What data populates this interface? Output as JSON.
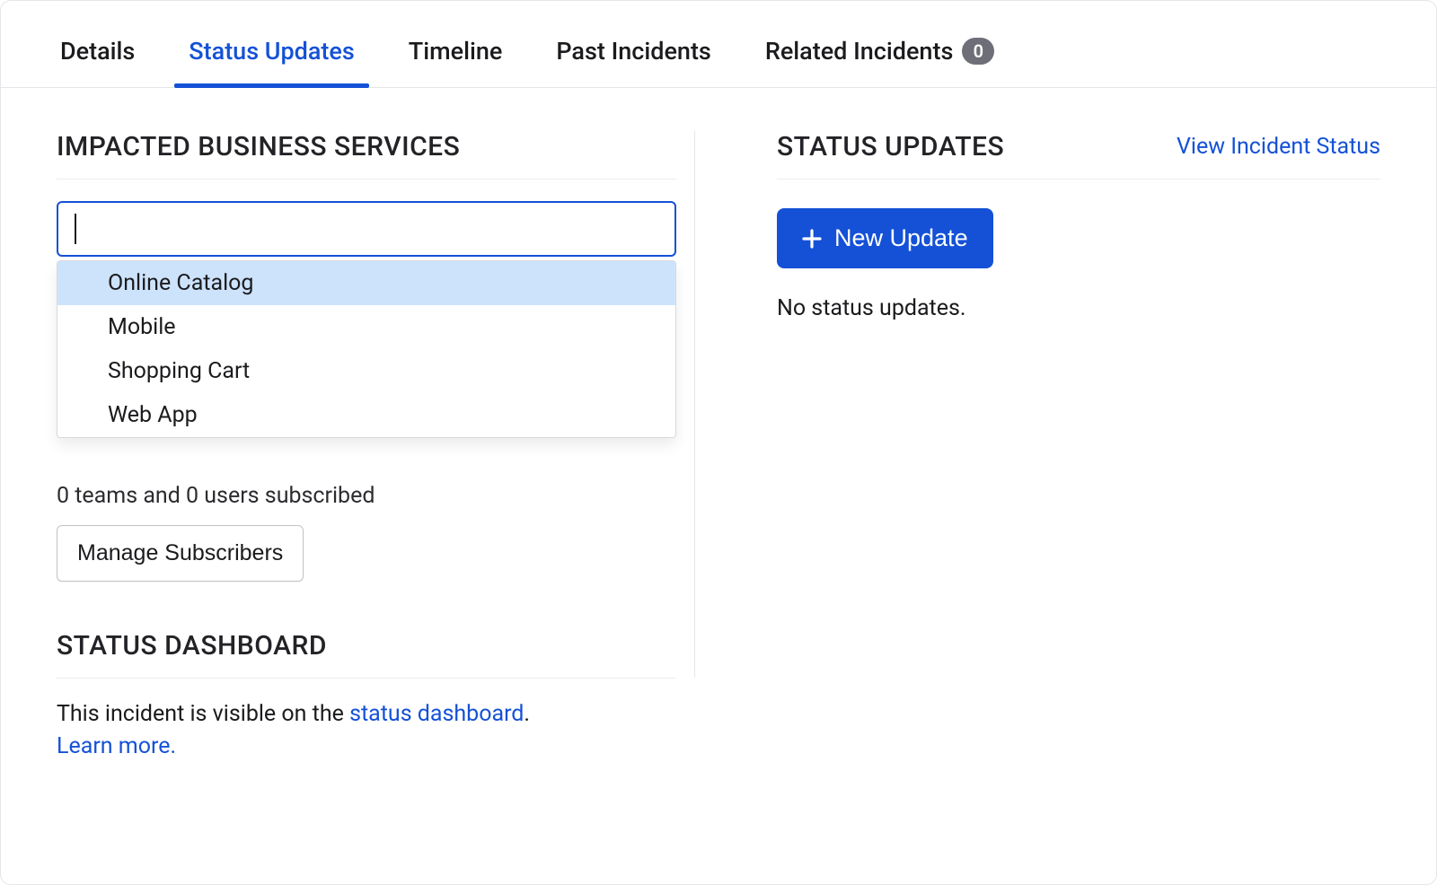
{
  "tabs": {
    "details": "Details",
    "status_updates": "Status Updates",
    "timeline": "Timeline",
    "past_incidents": "Past Incidents",
    "related_incidents": "Related Incidents",
    "related_count": "0"
  },
  "left": {
    "heading": "IMPACTED BUSINESS SERVICES",
    "combo_placeholder": "",
    "options": [
      "Online Catalog",
      "Mobile",
      "Shopping Cart",
      "Web App"
    ],
    "subscribed_text": "0 teams and 0 users subscribed",
    "manage_subscribers": "Manage Subscribers",
    "dashboard_heading": "STATUS DASHBOARD",
    "dashboard_text_pre": "This incident is visible on the ",
    "dashboard_link": "status dashboard",
    "dashboard_text_post": ".",
    "learn_more": "Learn more."
  },
  "right": {
    "heading": "STATUS UPDATES",
    "view_link": "View Incident Status",
    "new_update": "New Update",
    "empty": "No status updates."
  }
}
